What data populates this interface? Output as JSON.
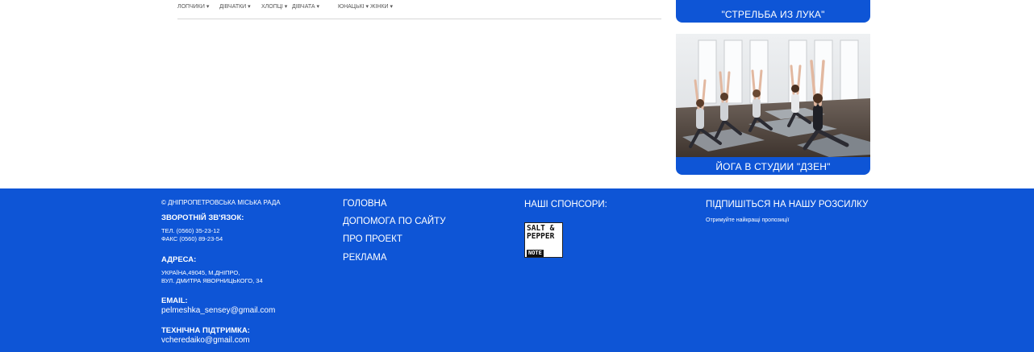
{
  "filters": {
    "items": [
      "ЛОПЧИКИ ▾",
      "ДІВЧАТКИ ▾",
      "ХЛОПЦІ ▾",
      "ДІВЧАТА ▾",
      "ЮНАЦЬКІ ▾",
      "ЖІНКИ ▾"
    ]
  },
  "cards": {
    "archery": "\"СТРЕЛЬБА ИЗ ЛУКА\"",
    "yoga": "ЙОГА В СТУДИИ \"ДЗЕН\""
  },
  "footer": {
    "copyright": "© ДНІПРОПЕТРОВСЬКА МІСЬКА РАДА",
    "feedback_heading": "ЗВОРОТНІЙ ЗВ'ЯЗОК:",
    "phone": "ТЕЛ. (0560) 35-23-12",
    "fax": "ФАКС (0560) 89-23-54",
    "address_heading": "АДРЕСА:",
    "address_line1": "УКРАЇНА,49045, М.ДНІПРО,",
    "address_line2": "ВУЛ. ДМИТРА ЯВОРНИЦЬКОГО, 34",
    "email_heading": "EMAIL:",
    "email": "pelmeshka_sensey@gmail.com",
    "support_heading": "ТЕХНІЧНА ПІДТРИМКА:",
    "support_email": "vcheredaiko@gmail.com",
    "menu": [
      "ГОЛОВНА",
      "ДОПОМОГА ПО САЙТУ",
      "ПРО ПРОЕКТ",
      "РЕКЛАМА"
    ],
    "sponsors_heading": "НАШІ СПОНСОРИ:",
    "sponsor_logo": {
      "line1": "SALT &",
      "line2": "PEPPER",
      "line3": "NOTE"
    },
    "subscribe_heading": "ПІДПИШІТЬСЯ НА НАШУ РОЗСИЛКУ",
    "subscribe_text": "Отримуйте найкращі пропозиції"
  },
  "colors": {
    "brand_blue": "#0e55d6",
    "white": "#ffffff"
  }
}
